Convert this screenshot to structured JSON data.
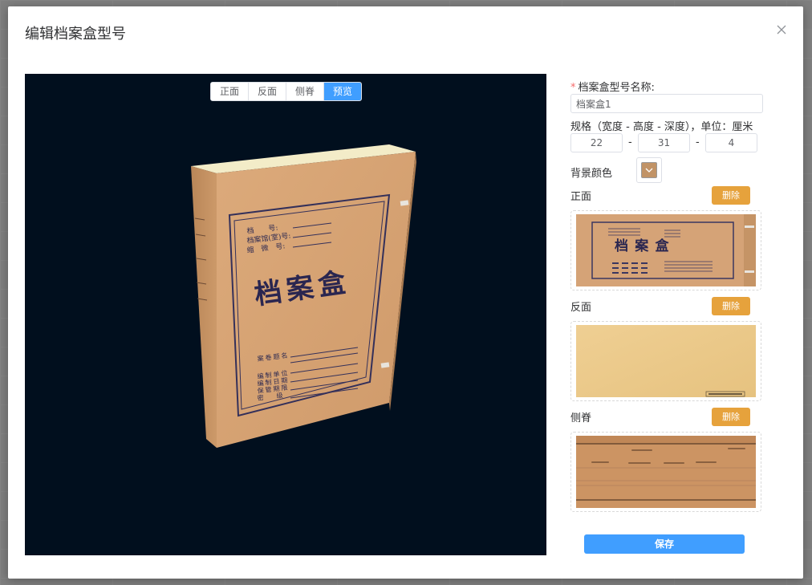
{
  "dialog": {
    "title": "编辑档案盒型号",
    "close_icon": "close-icon"
  },
  "preview": {
    "tabs": [
      {
        "label": "正面",
        "active": false
      },
      {
        "label": "反面",
        "active": false
      },
      {
        "label": "侧脊",
        "active": false
      },
      {
        "label": "预览",
        "active": true
      }
    ],
    "background_color": "#010f1e",
    "box": {
      "labels_top": [
        "档　　号:",
        "档案馆(室)号:",
        "缩　微　号:"
      ],
      "title": "档案盒",
      "labels_bottom": [
        "案 卷 题 名",
        "编 制 单 位",
        "编 制 日 期",
        "保 管 期 限",
        "密　　级"
      ]
    }
  },
  "form": {
    "name_label": "档案盒型号名称:",
    "name_value": "档案盒1",
    "spec_label": "规格（宽度 - 高度 - 深度），单位：厘米",
    "width": "22",
    "height": "31",
    "depth": "4",
    "dash": "-",
    "bg_color_label": "背景颜色",
    "bg_color": "#c19366",
    "front_label": "正面",
    "back_label": "反面",
    "spine_label": "侧脊",
    "delete_label": "删除",
    "front_thumb_title": "档 案 盒",
    "save_label": "保存"
  },
  "colors": {
    "primary": "#409eff",
    "warning": "#e6a23c",
    "kraft": "#d9a574"
  }
}
